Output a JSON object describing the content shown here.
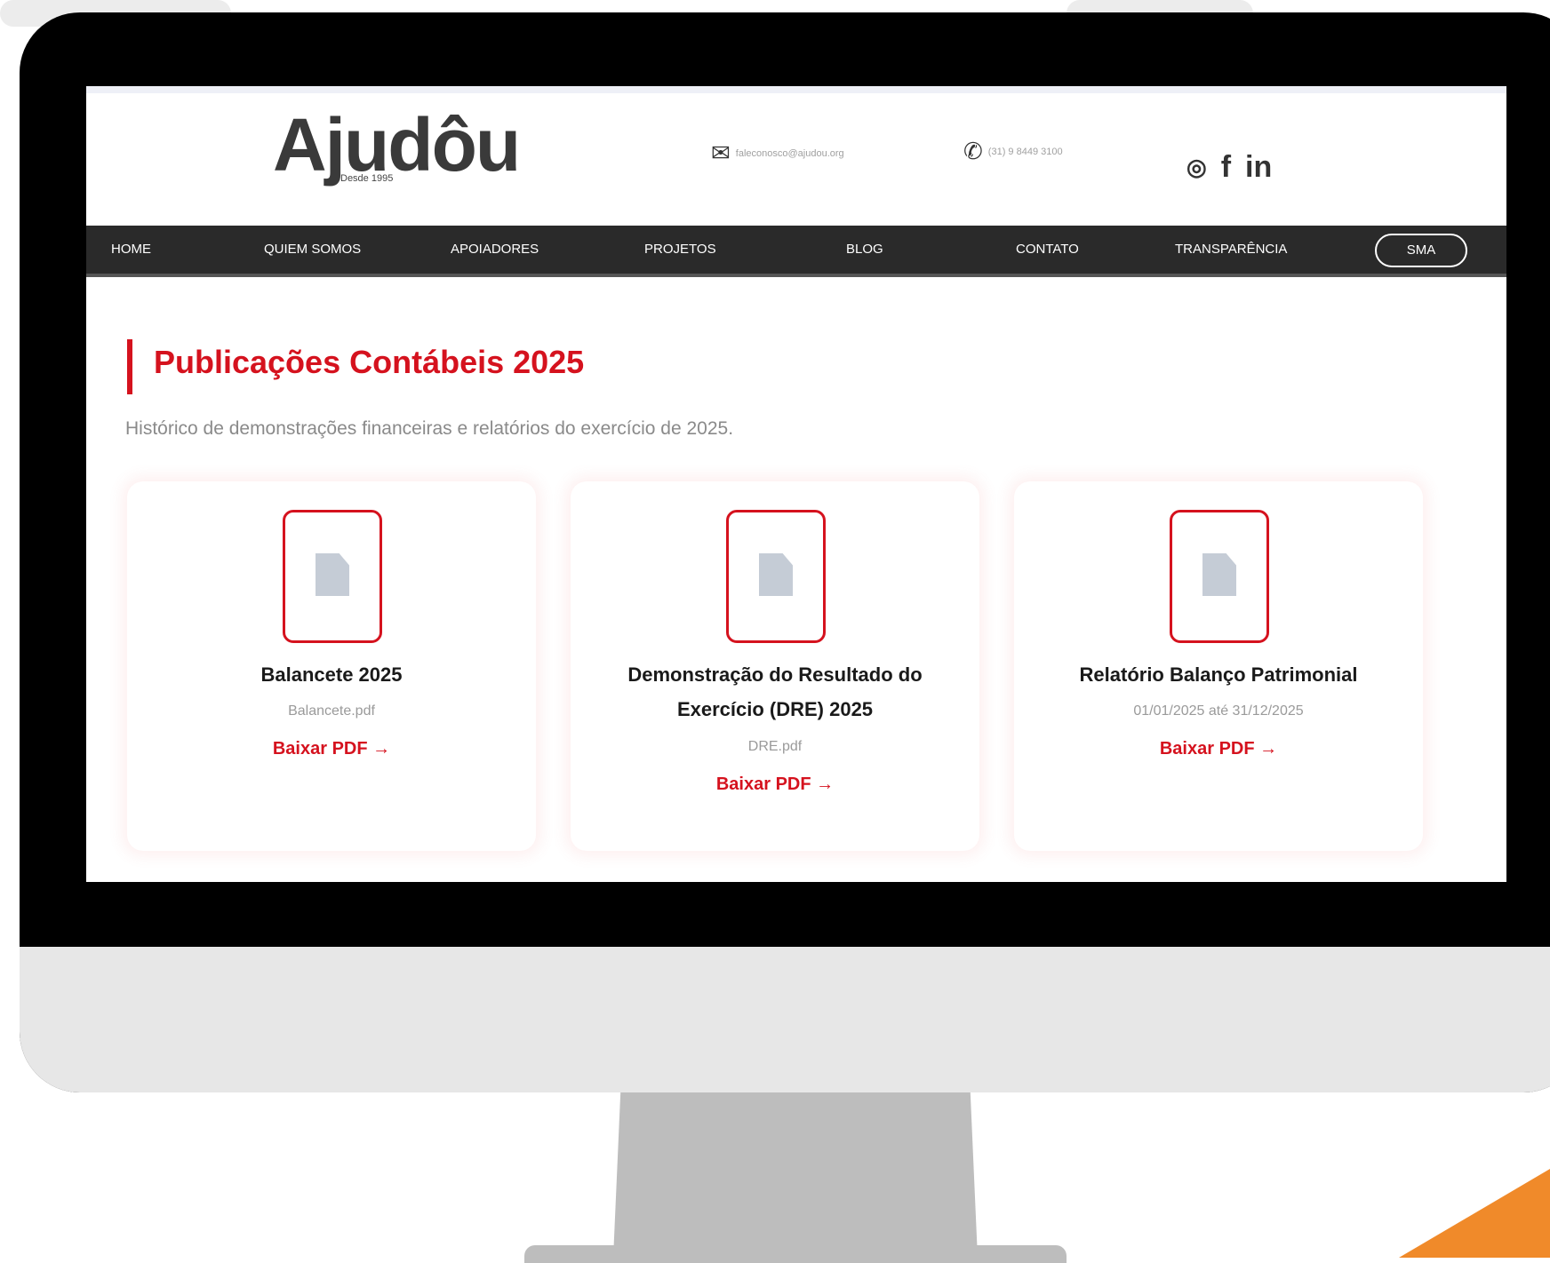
{
  "header": {
    "logo_text": "Ajudôu",
    "logo_subtitle": "Desde 1995",
    "email": "faleconosco@ajudou.org",
    "phone": "(31) 9 8449 3100"
  },
  "nav": {
    "items": [
      "HOME",
      "QUIEM SOMOS",
      "APOIADORES",
      "PROJETOS",
      "BLOG",
      "CONTATO",
      "TRANSPARÊNCIA"
    ],
    "button": "SMA"
  },
  "page": {
    "title": "Publicações Contábeis 2025",
    "subtitle": "Histórico de demonstrações financeiras e relatórios do exercício de 2025."
  },
  "cards": [
    {
      "title_line1": "Balancete 2025",
      "title_line2": "",
      "meta": "Balancete.pdf",
      "link": "Baixar PDF →"
    },
    {
      "title_line1": "Demonstração do Resultado do",
      "title_line2": "Exercício (DRE) 2025",
      "meta": "DRE.pdf",
      "link": "Baixar PDF →"
    },
    {
      "title_line1": "Relatório Balanço Patrimonial",
      "title_line2": "",
      "meta": "01/01/2025 até 31/12/2025",
      "link": "Baixar PDF →"
    }
  ],
  "icons": {
    "email": "mail-icon",
    "phone": "whatsapp-icon",
    "social": [
      "instagram-icon",
      "facebook-icon",
      "linkedin-icon"
    ],
    "document": "document-icon"
  },
  "colors": {
    "accent": "#d5121e",
    "nav_bg": "#2a2a2a",
    "orange": "#f08a2a"
  }
}
